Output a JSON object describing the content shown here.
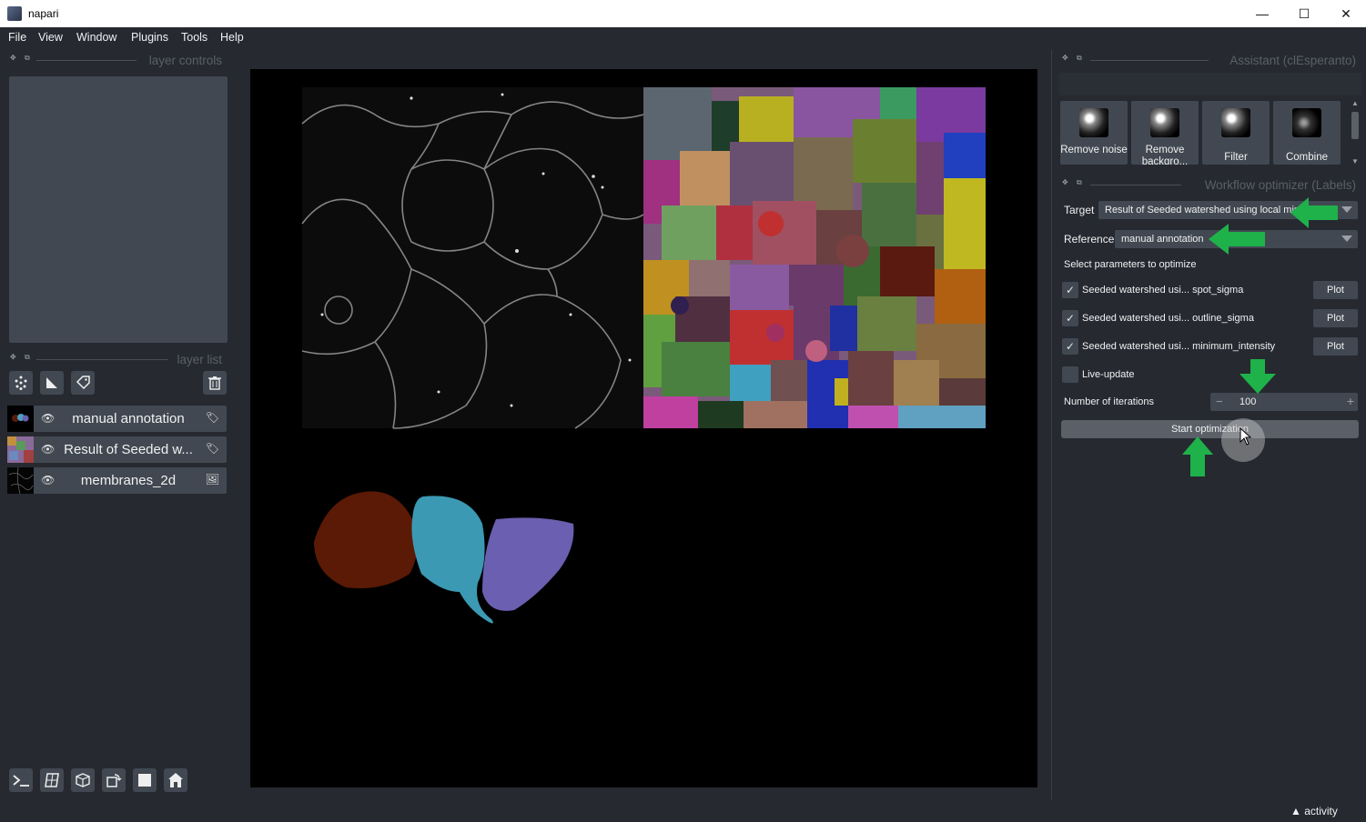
{
  "window": {
    "title": "napari",
    "minimize": "—",
    "maximize": "☐",
    "close": "✕"
  },
  "menu": [
    "File",
    "View",
    "Window",
    "Plugins",
    "Tools",
    "Help"
  ],
  "left_panel": {
    "layer_controls_title": "layer controls",
    "layer_list_title": "layer list",
    "layers": [
      {
        "name": "manual annotation",
        "type": "labels",
        "visible": true
      },
      {
        "name": "Result of Seeded w...",
        "type": "labels",
        "visible": true
      },
      {
        "name": "membranes_2d",
        "type": "image",
        "visible": true
      }
    ]
  },
  "right_panel": {
    "assistant_title": "Assistant (clEsperanto)",
    "assistant_buttons": [
      {
        "label": "Remove noise"
      },
      {
        "label": "Remove backgro..."
      },
      {
        "label": "Filter"
      },
      {
        "label": "Combine"
      }
    ],
    "optimizer_title": "Workflow optimizer (Labels)",
    "target_label": "Target",
    "target_value": "Result of Seeded watershed using local min",
    "reference_label": "Reference",
    "reference_value": "manual annotation",
    "params_heading": "Select parameters to optimize",
    "params": [
      {
        "label": "Seeded watershed usi... spot_sigma",
        "checked": true,
        "plot": "Plot"
      },
      {
        "label": "Seeded watershed usi... outline_sigma",
        "checked": true,
        "plot": "Plot"
      },
      {
        "label": "Seeded watershed usi... minimum_intensity",
        "checked": true,
        "plot": "Plot"
      }
    ],
    "live_update_label": "Live-update",
    "iterations_label": "Number of iterations",
    "iterations_value": "100",
    "minus": "−",
    "plus": "+",
    "start_button": "Start optimization"
  },
  "status": {
    "activity": "▲ activity"
  },
  "colors": {
    "background": "#262930",
    "panel": "#414851",
    "arrow": "#1fb14a"
  }
}
